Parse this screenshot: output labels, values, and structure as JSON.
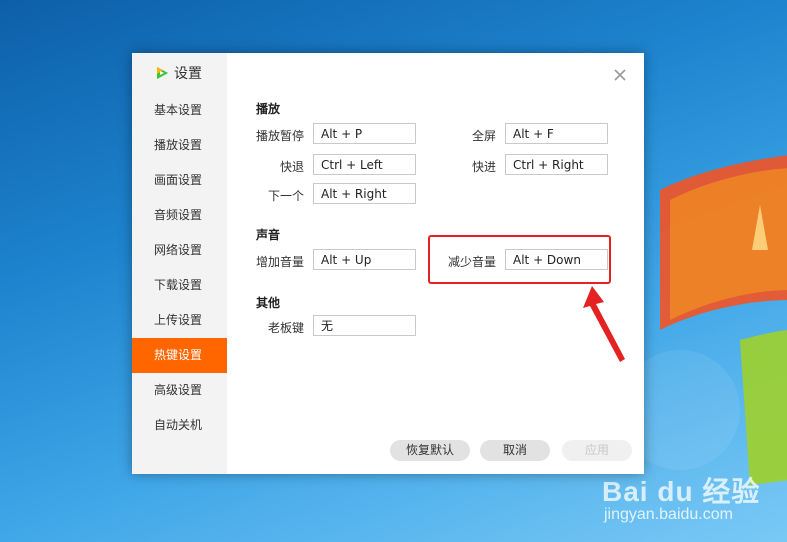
{
  "dialog": {
    "title": "设置",
    "accent_color": "#ff6600",
    "sidebar": {
      "items": [
        {
          "label": "基本设置"
        },
        {
          "label": "播放设置"
        },
        {
          "label": "画面设置"
        },
        {
          "label": "音频设置"
        },
        {
          "label": "网络设置"
        },
        {
          "label": "下载设置"
        },
        {
          "label": "上传设置"
        },
        {
          "label": "热键设置",
          "active": true
        },
        {
          "label": "高级设置"
        },
        {
          "label": "自动关机"
        }
      ]
    },
    "sections": {
      "playback": {
        "title": "播放",
        "play_pause": {
          "label": "播放暂停",
          "value": "Alt + P"
        },
        "fullscreen": {
          "label": "全屏",
          "value": "Alt + F"
        },
        "rewind": {
          "label": "快退",
          "value": "Ctrl + Left"
        },
        "forward": {
          "label": "快进",
          "value": "Ctrl + Right"
        },
        "next": {
          "label": "下一个",
          "value": "Alt + Right"
        }
      },
      "sound": {
        "title": "声音",
        "volume_up": {
          "label": "增加音量",
          "value": "Alt + Up"
        },
        "volume_down": {
          "label": "减少音量",
          "value": "Alt + Down"
        }
      },
      "other": {
        "title": "其他",
        "boss_key": {
          "label": "老板键",
          "value": "无"
        }
      }
    },
    "buttons": {
      "reset": "恢复默认",
      "cancel": "取消",
      "apply": "应用"
    },
    "annotation_color": "#e52222"
  },
  "watermark": {
    "brand": "Bai du 经验",
    "url": "jingyan.baidu.com"
  },
  "icons": {
    "logo": "tencent-video-logo-icon",
    "close": "close-icon"
  }
}
